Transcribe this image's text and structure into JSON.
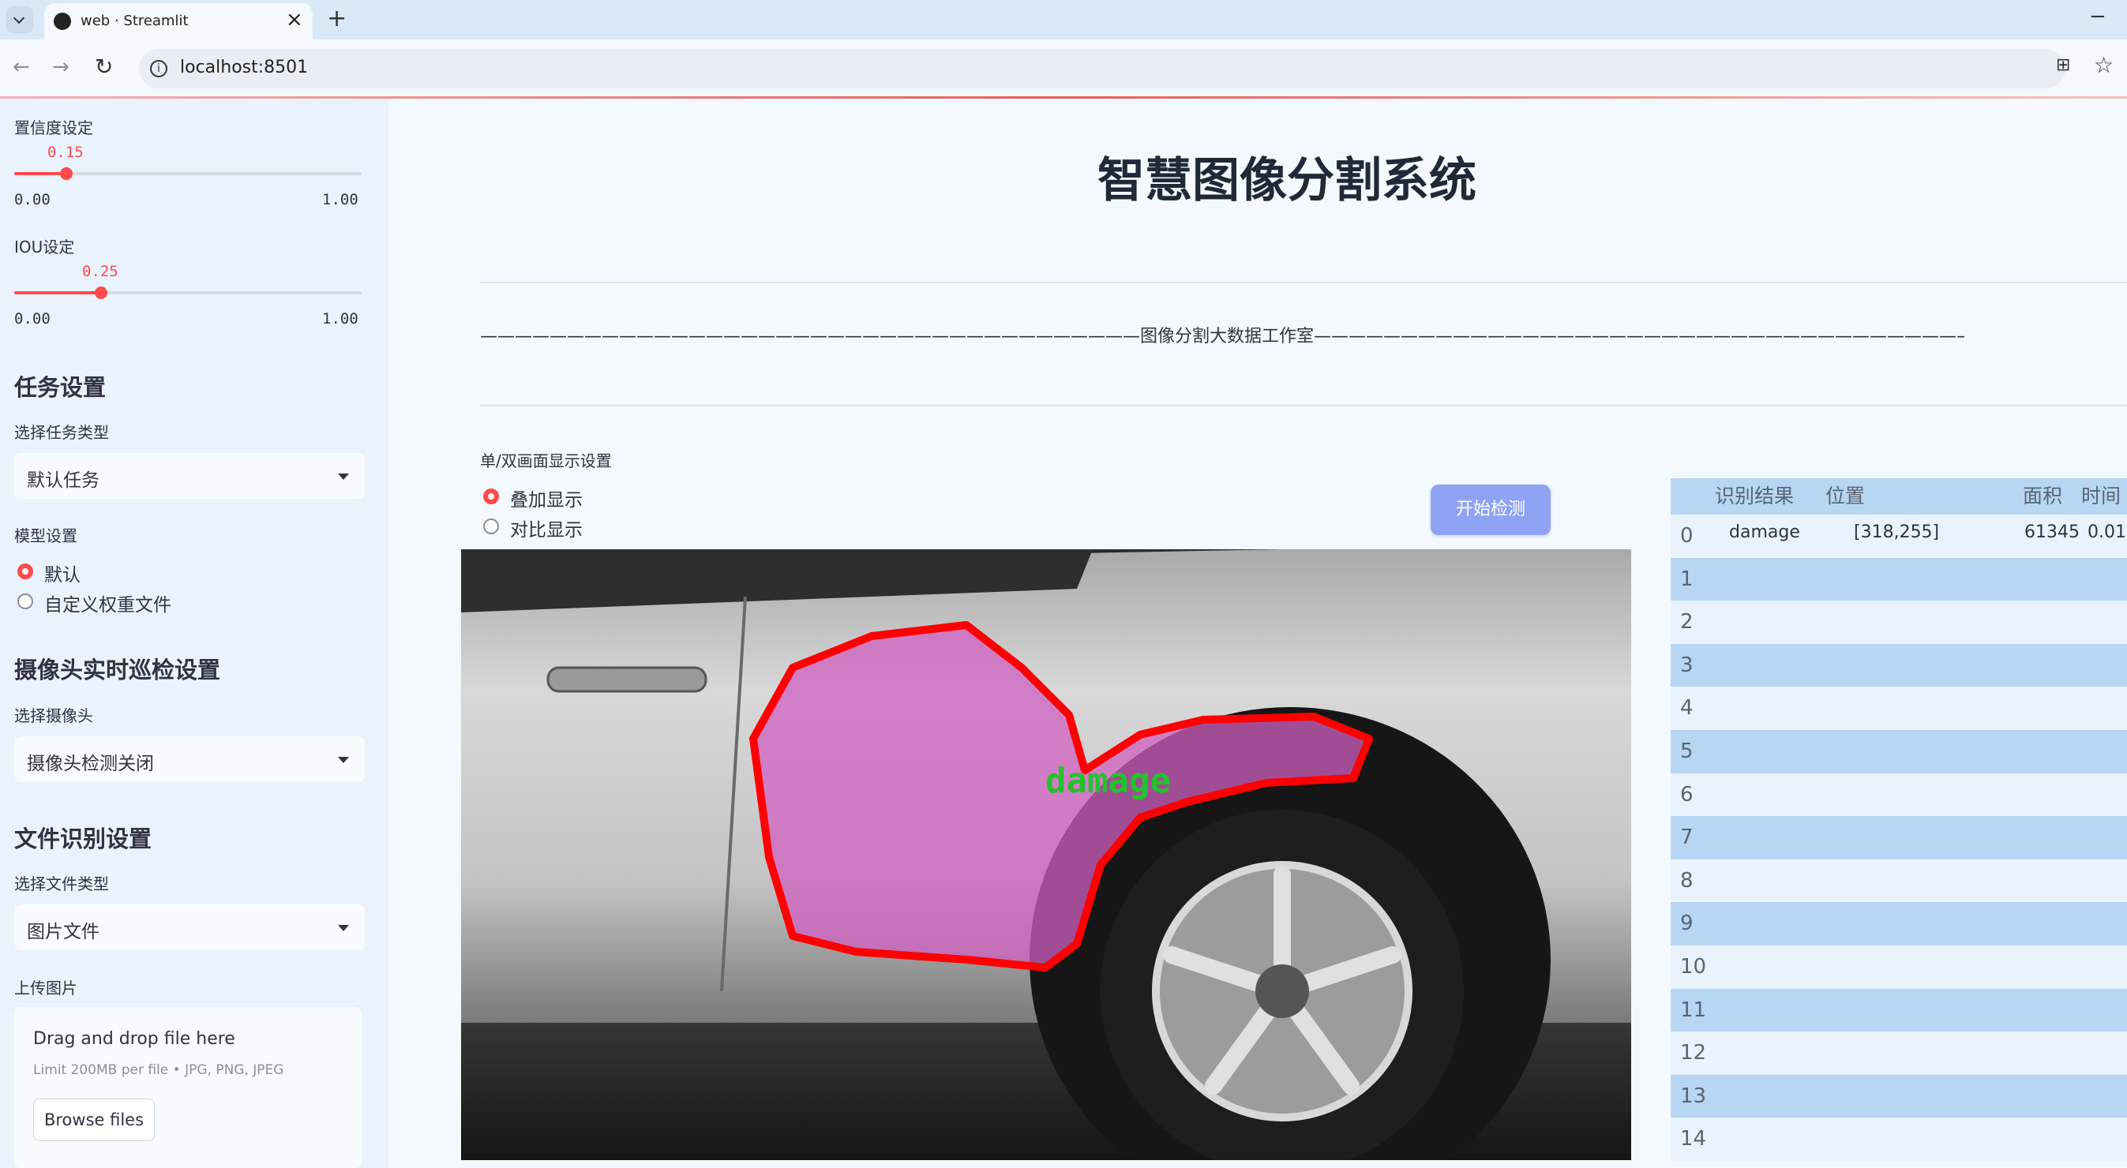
{
  "browser": {
    "tab_title": "web · Streamlit",
    "close_tab": "×",
    "new_tab": "+",
    "minimize": "−",
    "url": "localhost:8501"
  },
  "sidebar": {
    "confidence": {
      "label": "置信度设定",
      "value": "0.15",
      "min": "0.00",
      "max": "1.00",
      "fraction": 0.15
    },
    "iou": {
      "label": "IOU设定",
      "value": "0.25",
      "min": "0.00",
      "max": "1.00",
      "fraction": 0.25
    },
    "task_section": "任务设置",
    "task_type_label": "选择任务类型",
    "task_type_value": "默认任务",
    "model_label": "模型设置",
    "model_options": [
      "默认",
      "自定义权重文件"
    ],
    "camera_section": "摄像头实时巡检设置",
    "camera_label": "选择摄像头",
    "camera_value": "摄像头检测关闭",
    "file_section": "文件识别设置",
    "file_type_label": "选择文件类型",
    "file_type_value": "图片文件",
    "upload_label": "上传图片",
    "dropzone_title": "Drag and drop file here",
    "dropzone_hint": "Limit 200MB per file • JPG, PNG, JPEG",
    "browse_button": "Browse files"
  },
  "main": {
    "title": "智慧图像分割系统",
    "subtitle": "——————————————————————————————————————图像分割大数据工作室——————————————————————————————————————",
    "display_setting_label": "单/双画面显示设置",
    "display_options": [
      "叠加显示",
      "对比显示"
    ],
    "start_button": "开始检测",
    "detection_label": "damage"
  },
  "table": {
    "headers": [
      "识别结果",
      "位置",
      "面积",
      "时间"
    ],
    "rows": [
      {
        "index": "0",
        "result": "damage",
        "position": "[318,255]",
        "area": "61345",
        "time": "0.01"
      },
      {
        "index": "1"
      },
      {
        "index": "2"
      },
      {
        "index": "3"
      },
      {
        "index": "4"
      },
      {
        "index": "5"
      },
      {
        "index": "6"
      },
      {
        "index": "7"
      },
      {
        "index": "8"
      },
      {
        "index": "9"
      },
      {
        "index": "10"
      },
      {
        "index": "11"
      },
      {
        "index": "12"
      },
      {
        "index": "13"
      },
      {
        "index": "14"
      }
    ]
  },
  "colors": {
    "accent": "#ff4b4b",
    "button": "#8fa3f5",
    "table_stripe": "#b7d6f4",
    "mask": "#d060c0",
    "mask_outline": "#ff0000",
    "label": "#22c22a"
  }
}
